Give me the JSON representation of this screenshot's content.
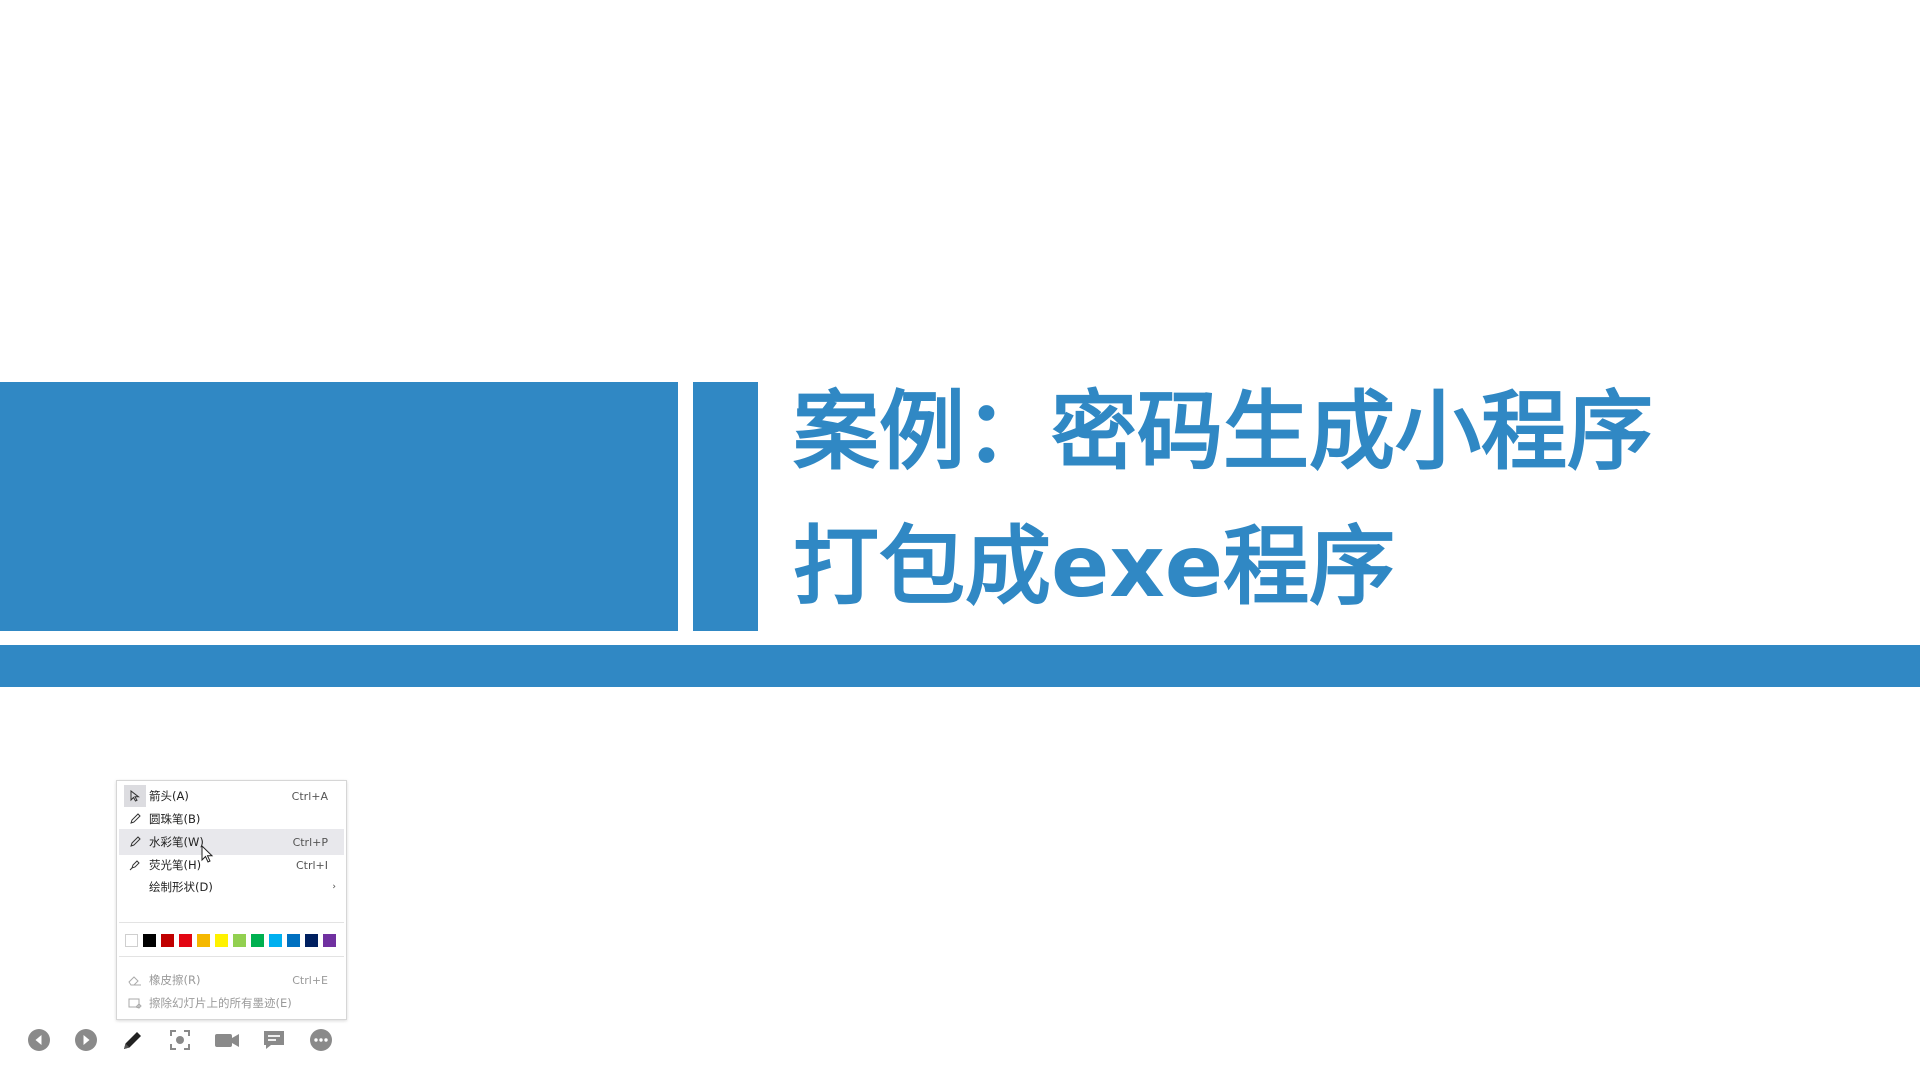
{
  "slide": {
    "title_line1": "案例：密码生成小程序",
    "title_line2": "打包成exe程序",
    "accent_color": "#3088c4"
  },
  "ink_menu": {
    "items": [
      {
        "label": "箭头(A)",
        "shortcut": "Ctrl+A",
        "icon": "arrow-pointer-icon",
        "selected": true
      },
      {
        "label": "圆珠笔(B)",
        "shortcut": "",
        "icon": "pen-icon"
      },
      {
        "label": "水彩笔(W)",
        "shortcut": "Ctrl+P",
        "icon": "pen-icon",
        "hovered": true
      },
      {
        "label": "荧光笔(H)",
        "shortcut": "Ctrl+I",
        "icon": "highlighter-icon"
      },
      {
        "label": "绘制形状(D)",
        "shortcut": "",
        "submenu": true
      }
    ],
    "colors": [
      "#ffffff",
      "#000000",
      "#c00000",
      "#e30613",
      "#f5b800",
      "#fff200",
      "#92d050",
      "#00b050",
      "#00b0f0",
      "#0070c0",
      "#002060",
      "#7030a0"
    ],
    "eraser": {
      "label": "橡皮擦(R)",
      "shortcut": "Ctrl+E",
      "icon": "eraser-icon"
    },
    "clear_ink": {
      "label": "擦除幻灯片上的所有墨迹(E)",
      "icon": "clear-ink-icon"
    }
  },
  "toolbar": {
    "buttons": [
      "previous-slide-icon",
      "next-slide-icon",
      "pen-tool-icon",
      "zoom-icon",
      "camera-icon",
      "subtitles-icon",
      "more-options-icon"
    ]
  }
}
